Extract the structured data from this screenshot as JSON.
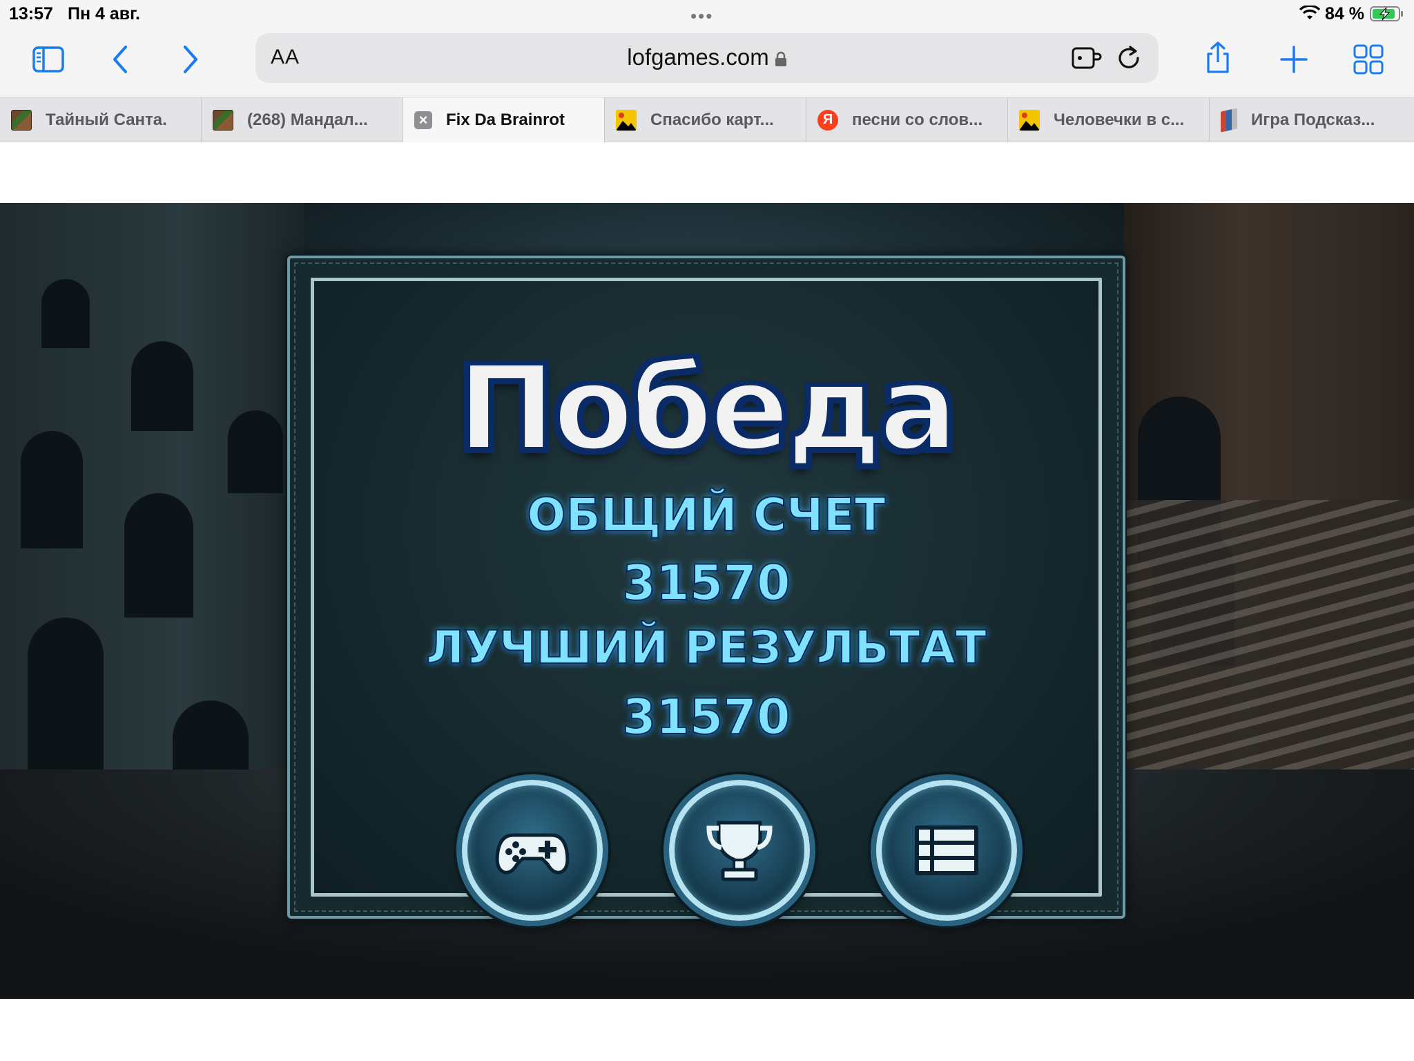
{
  "status_bar": {
    "time": "13:57",
    "date": "Пн 4 авг.",
    "battery_percent": "84 %",
    "icons": [
      "wifi-icon",
      "battery-charging-icon"
    ]
  },
  "toolbar": {
    "address_aa": "AA",
    "url": "lofgames.com",
    "icons": [
      "sidebar-icon",
      "back-icon",
      "forward-icon",
      "lock-icon",
      "extension-icon",
      "reload-icon",
      "share-icon",
      "plus-icon",
      "tabs-grid-icon"
    ]
  },
  "tabs": [
    {
      "title": "Тайный Санта.",
      "icon": "minecraft-favicon"
    },
    {
      "title": "(268) Мандал...",
      "icon": "minecraft-favicon"
    },
    {
      "title": "Fix Da Brainrot",
      "icon": "close-icon",
      "active": true
    },
    {
      "title": "Спасибо карт...",
      "icon": "image-favicon"
    },
    {
      "title": "песни со слов...",
      "icon": "yandex-favicon"
    },
    {
      "title": "Человечки в с...",
      "icon": "image-favicon"
    },
    {
      "title": "Игра Подсказ...",
      "icon": "books-favicon"
    }
  ],
  "game": {
    "title": "Победа",
    "total_score_label": "ОБЩИЙ СЧЕТ",
    "total_score": "31570",
    "best_result_label": "ЛУЧШИЙ РЕЗУЛЬТАТ",
    "best_result": "31570",
    "buttons": [
      "gamepad-icon",
      "trophy-icon",
      "list-icon"
    ]
  },
  "colors": {
    "accent_blue": "#1a7cf2",
    "score_cyan": "#7fe3ff",
    "title_outline": "#0b2b66"
  }
}
